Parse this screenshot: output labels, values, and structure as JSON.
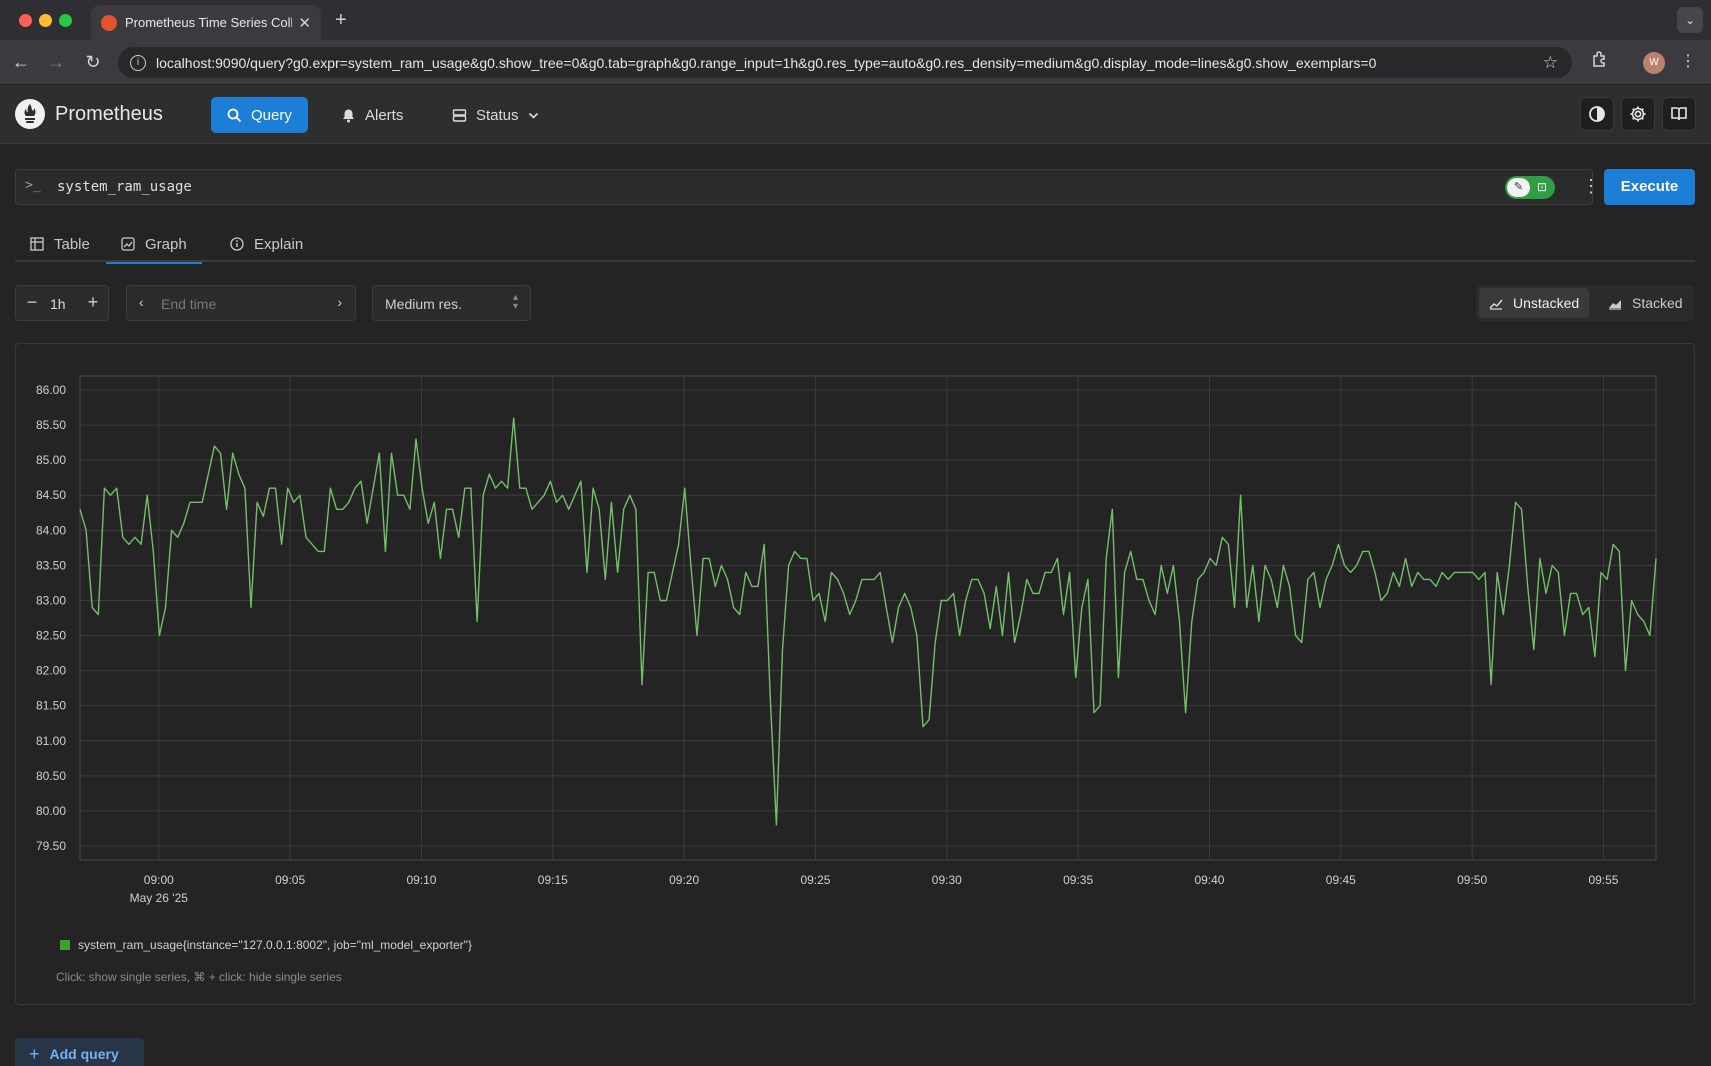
{
  "browser": {
    "tab_title": "Prometheus Time Series Colle",
    "url": "localhost:9090/query?g0.expr=system_ram_usage&g0.show_tree=0&g0.tab=graph&g0.range_input=1h&g0.res_type=auto&g0.res_density=medium&g0.display_mode=lines&g0.show_exemplars=0",
    "profile_initial": "W"
  },
  "app": {
    "brand": "Prometheus",
    "nav": {
      "query": "Query",
      "alerts": "Alerts",
      "status": "Status"
    }
  },
  "query": {
    "prompt": ">_",
    "expression": "system_ram_usage",
    "execute_label": "Execute",
    "tabs": {
      "table": "Table",
      "graph": "Graph",
      "explain": "Explain"
    },
    "active_tab": "Graph",
    "range": "1h",
    "end_time_placeholder": "End time",
    "resolution": "Medium res.",
    "display_modes": {
      "unstacked": "Unstacked",
      "stacked": "Stacked"
    },
    "active_display_mode": "Unstacked"
  },
  "chart_data": {
    "type": "line",
    "y_ticks": [
      "86.00",
      "85.50",
      "85.00",
      "84.50",
      "84.00",
      "83.50",
      "83.00",
      "82.50",
      "82.00",
      "81.50",
      "81.00",
      "80.50",
      "80.00",
      "79.50"
    ],
    "ylim": [
      79.3,
      86.2
    ],
    "x_ticks": [
      "09:00",
      "09:05",
      "09:10",
      "09:15",
      "09:20",
      "09:25",
      "09:30",
      "09:35",
      "09:40",
      "09:45",
      "09:50",
      "09:55"
    ],
    "x_date_label": "May 26 '25",
    "x_range": [
      "08:57",
      "09:57"
    ],
    "grid": true,
    "series": [
      {
        "name": "system_ram_usage{instance=\"127.0.0.1:8002\", job=\"ml_model_exporter\"}",
        "color": "#73bf69",
        "values": [
          84.3,
          84.0,
          82.9,
          82.8,
          84.6,
          84.5,
          84.6,
          83.9,
          83.8,
          83.9,
          83.8,
          84.5,
          83.7,
          82.5,
          82.9,
          84.0,
          83.9,
          84.1,
          84.4,
          84.4,
          84.4,
          84.8,
          85.2,
          85.1,
          84.3,
          85.1,
          84.8,
          84.6,
          82.9,
          84.4,
          84.2,
          84.6,
          84.6,
          83.8,
          84.6,
          84.4,
          84.5,
          83.9,
          83.8,
          83.7,
          83.7,
          84.6,
          84.3,
          84.3,
          84.4,
          84.6,
          84.7,
          84.1,
          84.6,
          85.1,
          83.7,
          85.1,
          84.5,
          84.5,
          84.3,
          85.3,
          84.6,
          84.1,
          84.4,
          83.6,
          84.3,
          84.3,
          83.9,
          84.6,
          84.6,
          82.7,
          84.5,
          84.8,
          84.6,
          84.7,
          84.6,
          85.6,
          84.6,
          84.6,
          84.3,
          84.4,
          84.5,
          84.7,
          84.4,
          84.5,
          84.3,
          84.5,
          84.7,
          83.4,
          84.6,
          84.3,
          83.3,
          84.4,
          83.4,
          84.3,
          84.5,
          84.3,
          81.8,
          83.4,
          83.4,
          83.0,
          83.0,
          83.4,
          83.8,
          84.6,
          83.5,
          82.5,
          83.6,
          83.6,
          83.2,
          83.5,
          83.3,
          82.9,
          82.8,
          83.4,
          83.2,
          83.2,
          83.8,
          81.6,
          79.8,
          82.3,
          83.5,
          83.7,
          83.6,
          83.6,
          83.0,
          83.1,
          82.7,
          83.4,
          83.3,
          83.1,
          82.8,
          83.0,
          83.3,
          83.3,
          83.3,
          83.4,
          82.9,
          82.4,
          82.9,
          83.1,
          82.9,
          82.5,
          81.2,
          81.3,
          82.4,
          83.0,
          83.0,
          83.1,
          82.5,
          83.0,
          83.3,
          83.3,
          83.1,
          82.6,
          83.2,
          82.5,
          83.4,
          82.4,
          82.8,
          83.3,
          83.1,
          83.1,
          83.4,
          83.4,
          83.6,
          82.8,
          83.4,
          81.9,
          82.9,
          83.3,
          81.4,
          81.5,
          83.6,
          84.3,
          81.9,
          83.4,
          83.7,
          83.3,
          83.3,
          83.0,
          82.8,
          83.5,
          83.1,
          83.5,
          82.7,
          81.4,
          82.7,
          83.3,
          83.4,
          83.6,
          83.5,
          83.9,
          83.8,
          82.9,
          84.5,
          82.9,
          83.5,
          82.7,
          83.5,
          83.3,
          82.9,
          83.5,
          83.2,
          82.5,
          82.4,
          83.3,
          83.4,
          82.9,
          83.3,
          83.5,
          83.8,
          83.5,
          83.4,
          83.5,
          83.7,
          83.7,
          83.4,
          83.0,
          83.1,
          83.4,
          83.2,
          83.6,
          83.2,
          83.4,
          83.3,
          83.3,
          83.2,
          83.4,
          83.3,
          83.4,
          83.4,
          83.4,
          83.4,
          83.3,
          83.4,
          81.8,
          83.4,
          82.8,
          83.5,
          84.4,
          84.3,
          83.2,
          82.3,
          83.6,
          83.1,
          83.5,
          83.4,
          82.5,
          83.1,
          83.1,
          82.8,
          82.9,
          82.2,
          83.4,
          83.3,
          83.8,
          83.7,
          82.0,
          83.0,
          82.8,
          82.7,
          82.5,
          83.6
        ]
      }
    ]
  },
  "graph": {
    "legend_label": "system_ram_usage{instance=\"127.0.0.1:8002\", job=\"ml_model_exporter\"}",
    "hint": "Click: show single series, ⌘ + click: hide single series"
  },
  "footer": {
    "add_query": "Add query"
  }
}
